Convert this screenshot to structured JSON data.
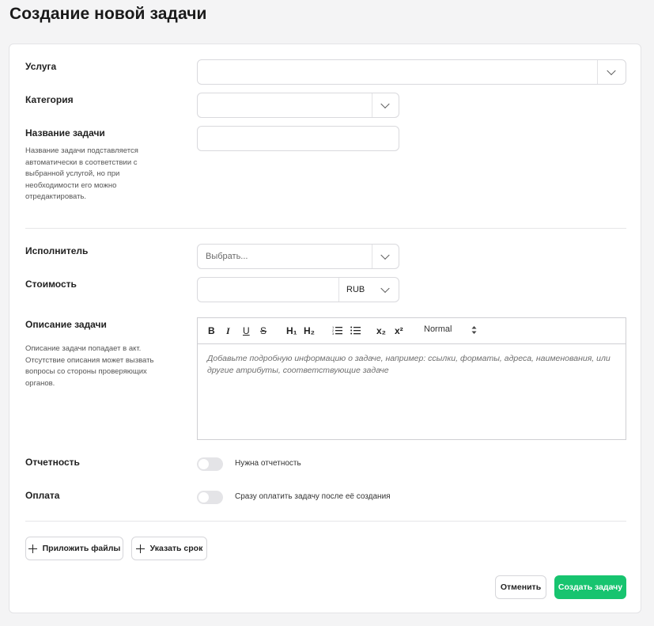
{
  "page": {
    "title": "Создание новой задачи"
  },
  "form": {
    "service": {
      "label": "Услуга",
      "value": ""
    },
    "category": {
      "label": "Категория",
      "value": ""
    },
    "task_name": {
      "label": "Название задачи",
      "hint": "Название задачи подставляется автоматически в соответствии с выбранной услугой, но при необходимости его можно отредактировать.",
      "value": ""
    },
    "assignee": {
      "label": "Исполнитель",
      "placeholder": "Выбрать..."
    },
    "cost": {
      "label": "Стоимость",
      "value": "",
      "currency": "RUB"
    },
    "description": {
      "label": "Описание задачи",
      "hint": "Описание задачи попадает в акт. Отсутствие описания может вызвать вопросы со стороны проверяющих органов.",
      "placeholder": "Добавьте подробную информацию о задаче, например: ссылки, форматы, адреса, наименования, или другие атрибуты, соответствующие задаче",
      "toolbar": {
        "bold": "B",
        "italic": "I",
        "underline": "U",
        "strike": "S",
        "h1": "H₁",
        "h2": "H₂",
        "subscript": "x₂",
        "superscript": "x²",
        "format": "Normal"
      }
    },
    "reporting": {
      "label": "Отчетность",
      "toggle_label": "Нужна отчетность",
      "enabled": false
    },
    "payment": {
      "label": "Оплата",
      "toggle_label": "Сразу оплатить задачу после её создания",
      "enabled": false
    }
  },
  "actions": {
    "attach_files": "Приложить файлы",
    "set_deadline": "Указать срок",
    "cancel": "Отменить",
    "create": "Создать задачу"
  },
  "colors": {
    "primary": "#17c46f",
    "border": "#d9d9dd",
    "toggle_off": "#e4e4e7"
  }
}
